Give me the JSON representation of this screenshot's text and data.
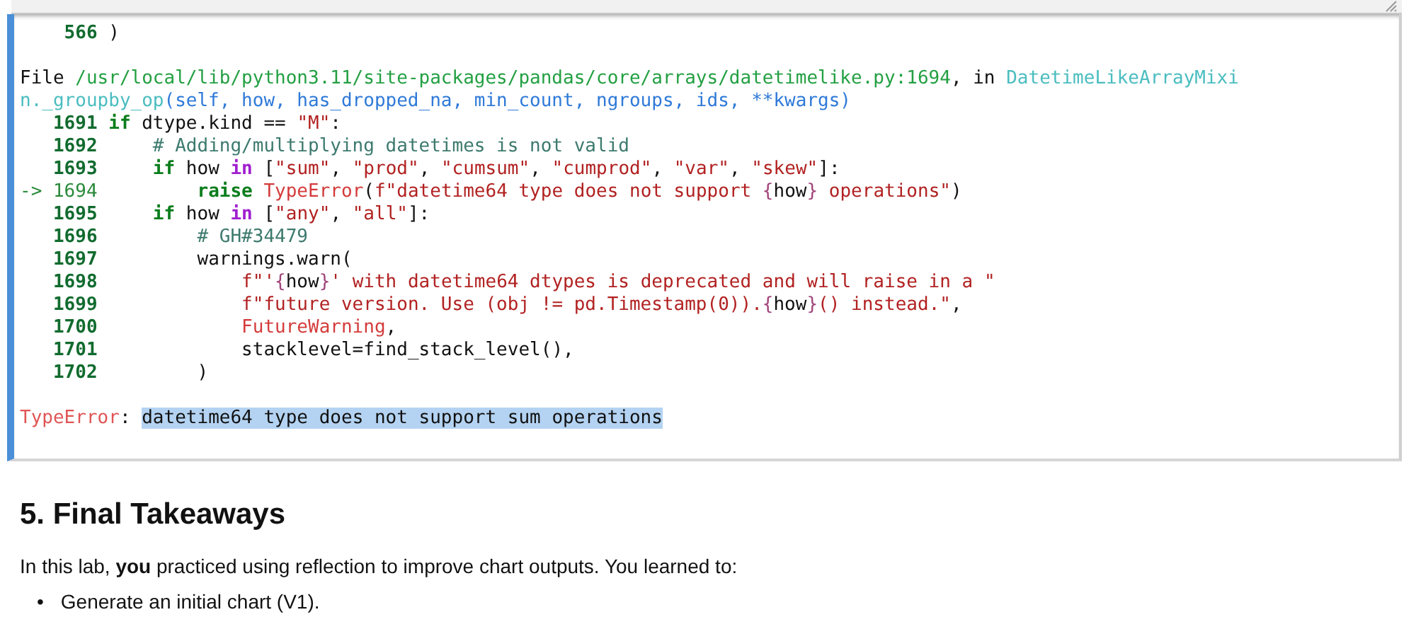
{
  "traceback": {
    "blocks": [
      {
        "lines": [
          {
            "segments": [
              {
                "kind": "ln",
                "text": "    566"
              },
              {
                "kind": "pl",
                "text": " )"
              }
            ]
          }
        ]
      },
      {
        "lines": [
          {
            "segments": [
              {
                "kind": "pl",
                "text": "File "
              },
              {
                "kind": "path",
                "text": "/usr/local/lib/python3.11/site-packages/pandas/core/arrays/datetimelike.py:1694"
              },
              {
                "kind": "pl",
                "text": ", in "
              },
              {
                "kind": "cls",
                "text": "DatetimeLikeArrayMixi"
              }
            ]
          },
          {
            "segments": [
              {
                "kind": "cls",
                "text": "n._groupby_op"
              },
              {
                "kind": "args",
                "text": "(self, how, has_dropped_na, min_count, ngroups, ids, **kwargs)"
              }
            ]
          },
          {
            "segments": [
              {
                "kind": "ln",
                "text": "   1691"
              },
              {
                "kind": "kw",
                "text": " if"
              },
              {
                "kind": "pl",
                "text": " dtype.kind == "
              },
              {
                "kind": "str",
                "text": "\"M\""
              },
              {
                "kind": "pl",
                "text": ":"
              }
            ]
          },
          {
            "segments": [
              {
                "kind": "ln",
                "text": "   1692"
              },
              {
                "kind": "cm",
                "text": "     # Adding/multiplying datetimes is not valid"
              }
            ]
          },
          {
            "segments": [
              {
                "kind": "ln",
                "text": "   1693"
              },
              {
                "kind": "kw",
                "text": "     if"
              },
              {
                "kind": "pl",
                "text": " how "
              },
              {
                "kind": "op",
                "text": "in"
              },
              {
                "kind": "pl",
                "text": " ["
              },
              {
                "kind": "str",
                "text": "\"sum\""
              },
              {
                "kind": "pl",
                "text": ", "
              },
              {
                "kind": "str",
                "text": "\"prod\""
              },
              {
                "kind": "pl",
                "text": ", "
              },
              {
                "kind": "str",
                "text": "\"cumsum\""
              },
              {
                "kind": "pl",
                "text": ", "
              },
              {
                "kind": "str",
                "text": "\"cumprod\""
              },
              {
                "kind": "pl",
                "text": ", "
              },
              {
                "kind": "str",
                "text": "\"var\""
              },
              {
                "kind": "pl",
                "text": ", "
              },
              {
                "kind": "str",
                "text": "\"skew\""
              },
              {
                "kind": "pl",
                "text": "]:"
              }
            ]
          },
          {
            "segments": [
              {
                "kind": "arrow",
                "text": "-> 1694"
              },
              {
                "kind": "kw",
                "text": "         raise"
              },
              {
                "kind": "exc",
                "text": " TypeError"
              },
              {
                "kind": "pl",
                "text": "("
              },
              {
                "kind": "str",
                "text": "f\"datetime64 type does not support "
              },
              {
                "kind": "brace",
                "text": "{"
              },
              {
                "kind": "pl",
                "text": "how"
              },
              {
                "kind": "brace",
                "text": "}"
              },
              {
                "kind": "str",
                "text": " operations\""
              },
              {
                "kind": "pl",
                "text": ")"
              }
            ]
          },
          {
            "segments": [
              {
                "kind": "ln",
                "text": "   1695"
              },
              {
                "kind": "kw",
                "text": "     if"
              },
              {
                "kind": "pl",
                "text": " how "
              },
              {
                "kind": "op",
                "text": "in"
              },
              {
                "kind": "pl",
                "text": " ["
              },
              {
                "kind": "str",
                "text": "\"any\""
              },
              {
                "kind": "pl",
                "text": ", "
              },
              {
                "kind": "str",
                "text": "\"all\""
              },
              {
                "kind": "pl",
                "text": "]:"
              }
            ]
          },
          {
            "segments": [
              {
                "kind": "ln",
                "text": "   1696"
              },
              {
                "kind": "cm",
                "text": "         # GH#34479"
              }
            ]
          },
          {
            "segments": [
              {
                "kind": "ln",
                "text": "   1697"
              },
              {
                "kind": "pl",
                "text": "         warnings.warn("
              }
            ]
          },
          {
            "segments": [
              {
                "kind": "ln",
                "text": "   1698"
              },
              {
                "kind": "str",
                "text": "             f\"'"
              },
              {
                "kind": "brace",
                "text": "{"
              },
              {
                "kind": "pl",
                "text": "how"
              },
              {
                "kind": "brace",
                "text": "}"
              },
              {
                "kind": "str",
                "text": "' with datetime64 dtypes is deprecated and will raise in a \""
              }
            ]
          },
          {
            "segments": [
              {
                "kind": "ln",
                "text": "   1699"
              },
              {
                "kind": "str",
                "text": "             f\"future version. Use (obj != pd.Timestamp(0))."
              },
              {
                "kind": "brace",
                "text": "{"
              },
              {
                "kind": "pl",
                "text": "how"
              },
              {
                "kind": "brace",
                "text": "}"
              },
              {
                "kind": "str",
                "text": "() instead.\""
              },
              {
                "kind": "pl",
                "text": ","
              }
            ]
          },
          {
            "segments": [
              {
                "kind": "ln",
                "text": "   1700"
              },
              {
                "kind": "exc",
                "text": "             FutureWarning"
              },
              {
                "kind": "pl",
                "text": ","
              }
            ]
          },
          {
            "segments": [
              {
                "kind": "ln",
                "text": "   1701"
              },
              {
                "kind": "pl",
                "text": "             stacklevel=find_stack_level(),"
              }
            ]
          },
          {
            "segments": [
              {
                "kind": "ln",
                "text": "   1702"
              },
              {
                "kind": "pl",
                "text": "         )"
              }
            ]
          }
        ]
      },
      {
        "lines": [
          {
            "segments": [
              {
                "kind": "err",
                "text": "TypeError"
              },
              {
                "kind": "pl",
                "text": ": "
              },
              {
                "kind": "hl",
                "text": "datetime64 type does not support sum operations"
              }
            ]
          }
        ]
      }
    ]
  },
  "section": {
    "heading": "5. Final Takeaways",
    "paragraph": "In this lab, **you** practiced using reflection to improve chart outputs. You learned to:",
    "bullets": [
      {
        "marker": "•",
        "text": "Generate an initial chart (V1)."
      }
    ]
  }
}
